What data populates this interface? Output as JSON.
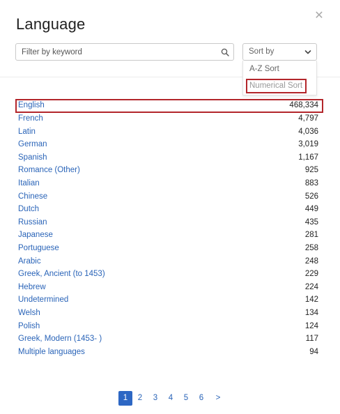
{
  "title": "Language",
  "search": {
    "placeholder": "Filter by keyword"
  },
  "sort": {
    "label": "Sort by",
    "options": [
      "A-Z Sort",
      "Numerical Sort"
    ],
    "highlighted": "Numerical Sort"
  },
  "languages": [
    {
      "name": "English",
      "count": "468,334"
    },
    {
      "name": "French",
      "count": "4,797"
    },
    {
      "name": "Latin",
      "count": "4,036"
    },
    {
      "name": "German",
      "count": "3,019"
    },
    {
      "name": "Spanish",
      "count": "1,167"
    },
    {
      "name": "Romance (Other)",
      "count": "925"
    },
    {
      "name": "Italian",
      "count": "883"
    },
    {
      "name": "Chinese",
      "count": "526"
    },
    {
      "name": "Dutch",
      "count": "449"
    },
    {
      "name": "Russian",
      "count": "435"
    },
    {
      "name": "Japanese",
      "count": "281"
    },
    {
      "name": "Portuguese",
      "count": "258"
    },
    {
      "name": "Arabic",
      "count": "248"
    },
    {
      "name": "Greek, Ancient (to 1453)",
      "count": "229"
    },
    {
      "name": "Hebrew",
      "count": "224"
    },
    {
      "name": "Undetermined",
      "count": "142"
    },
    {
      "name": "Welsh",
      "count": "134"
    },
    {
      "name": "Polish",
      "count": "124"
    },
    {
      "name": "Greek, Modern (1453- )",
      "count": "117"
    },
    {
      "name": "Multiple languages",
      "count": "94"
    }
  ],
  "selected_language": "English",
  "pagination": {
    "pages": [
      "1",
      "2",
      "3",
      "4",
      "5",
      "6"
    ],
    "current": "1",
    "next_label": ">"
  },
  "colors": {
    "link": "#2a64b8",
    "highlight_border": "#b3262b",
    "active_page": "#2d67c4"
  },
  "icons": {
    "close": "close-icon",
    "search": "search-icon",
    "dropdown": "chevron-down-icon"
  }
}
